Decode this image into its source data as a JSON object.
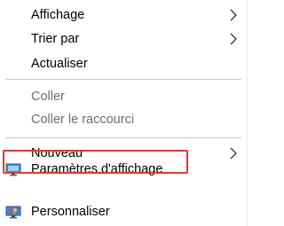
{
  "menu": {
    "items": [
      {
        "label": "Affichage"
      },
      {
        "label": "Trier par"
      },
      {
        "label": "Actualiser"
      },
      {
        "label": "Coller"
      },
      {
        "label": "Coller le raccourci"
      },
      {
        "label": "Nouveau"
      },
      {
        "label": "Paramètres d'affichage",
        "icon": "display-settings-icon"
      },
      {
        "label": "Personnaliser",
        "icon": "personalize-icon"
      }
    ],
    "submenu_icon": "chevron-right-icon",
    "text_color": "#000000",
    "disabled_color": "#6d6d6d",
    "highlight_color": "#e0382f"
  }
}
